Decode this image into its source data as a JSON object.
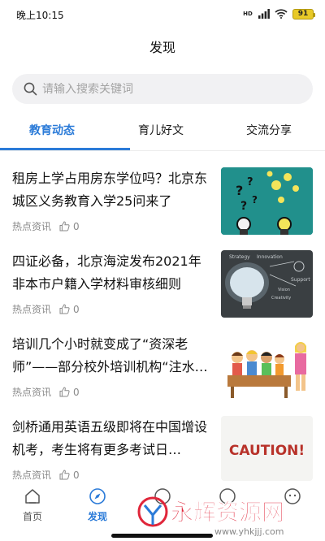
{
  "status_bar": {
    "time": "晚上10:15",
    "network": "HD",
    "battery": "91"
  },
  "header": {
    "title": "发现"
  },
  "search": {
    "placeholder": "请输入搜索关键词",
    "value": ""
  },
  "tabs": [
    {
      "label": "教育动态",
      "active": true
    },
    {
      "label": "育儿好文",
      "active": false
    },
    {
      "label": "交流分享",
      "active": false
    }
  ],
  "articles": [
    {
      "title": "租房上学占用房东学位吗？北京东城区义务教育入学25问来了",
      "category": "热点资讯",
      "likes": "0",
      "thumb": "question-lightbulb-illustration"
    },
    {
      "title": "四证必备，北京海淀发布2021年非本市户籍入学材料审核细则",
      "category": "热点资讯",
      "likes": "0",
      "thumb": "chalkboard-lightbulb-photo"
    },
    {
      "title": "培训几个小时就变成了“资深老师”——部分校外培训机构“注水…",
      "category": "热点资讯",
      "likes": "0",
      "thumb": "classroom-cartoon"
    },
    {
      "title": "剑桥通用英语五级即将在中国增设机考，考生将有更多考试日…",
      "category": "热点资讯",
      "likes": "0",
      "thumb": "caution-sign"
    }
  ],
  "thumb_text": {
    "caution": "CAUTION!",
    "board_words": [
      "Strategy",
      "Innovation",
      "Support",
      "Vision",
      "Creativity"
    ]
  },
  "tabbar": [
    {
      "label": "首页",
      "icon": "home-icon",
      "active": false
    },
    {
      "label": "发现",
      "icon": "compass-icon",
      "active": true
    },
    {
      "label": "",
      "icon": "center-icon",
      "active": false
    },
    {
      "label": "",
      "icon": "chat-icon",
      "active": false
    },
    {
      "label": "",
      "icon": "profile-icon",
      "active": false
    }
  ],
  "watermark": {
    "text": "永辉资源网",
    "url": "www.yhkjjj.com"
  },
  "colors": {
    "accent": "#2b7bd8",
    "battery": "#e8c927",
    "watermark": "#e0263a"
  }
}
